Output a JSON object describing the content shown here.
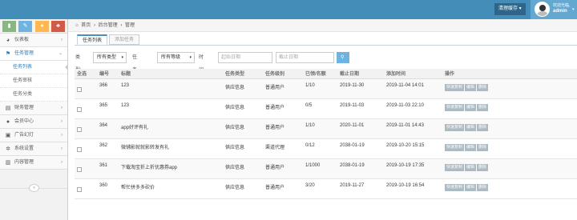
{
  "header": {
    "clear_cache_label": "清理缓存",
    "user_greeting": "欢迎光临,",
    "user_name": "admin"
  },
  "sidebar": {
    "shortcut_colors": [
      "#87b87f",
      "#6fb3e0",
      "#ffb752",
      "#d15b47"
    ],
    "items": [
      {
        "label": "仪表板",
        "icon": "dashboard-icon",
        "glyph": "◕"
      },
      {
        "label": "任务管理",
        "icon": "flag-icon",
        "glyph": "⚑",
        "open": true,
        "children": [
          "任务列表",
          "任务审核",
          "任务分类"
        ]
      },
      {
        "label": "财务管理",
        "icon": "wallet-icon",
        "glyph": "▤"
      },
      {
        "label": "会员中心",
        "icon": "user-icon",
        "glyph": "●"
      },
      {
        "label": "广告幻灯",
        "icon": "image-icon",
        "glyph": "▣"
      },
      {
        "label": "系统设置",
        "icon": "gear-icon",
        "glyph": "✲"
      },
      {
        "label": "内容管理",
        "icon": "book-icon",
        "glyph": "▥"
      }
    ]
  },
  "breadcrumb": [
    "首页",
    "后台管理",
    "管理"
  ],
  "tabs": [
    "任务列表",
    "添加任务"
  ],
  "filters": {
    "type_label": "类型:",
    "type_value": "所有类型",
    "level_label": "任务等级:",
    "level_value": "所有等级",
    "time_label": "时间段:",
    "start_placeholder": "起始日期",
    "end_placeholder": "截止日期",
    "search_label": "搜索"
  },
  "table": {
    "headers": [
      "全选",
      "编号",
      "标题",
      "任务类型",
      "任务级别",
      "已领/名额",
      "截止日期",
      "添加时间",
      "操作"
    ],
    "action_labels": [
      "快速复制",
      "编辑",
      "删除"
    ],
    "rows": [
      [
        "366",
        "123",
        "供应信息",
        "普通用户",
        "1/10",
        "2019-11-30",
        "2019-11-04 14:01"
      ],
      [
        "365",
        "123",
        "供应信息",
        "普通用户",
        "0/5",
        "2019-11-03",
        "2019-11-03 22:10"
      ],
      [
        "364",
        "app好评有礼",
        "供应信息",
        "普通用户",
        "1/10",
        "2020-11-01",
        "2019-11-01 14:43"
      ],
      [
        "362",
        "微铺影就就影转发有礼",
        "供应信息",
        "渠道代理",
        "0/12",
        "2038-01-19",
        "2019-10-20 15:15"
      ],
      [
        "361",
        "下载淘宝折上折优惠券app",
        "供应信息",
        "普通用户",
        "1/1000",
        "2038-01-19",
        "2019-10-19 17:35"
      ],
      [
        "360",
        "帮忙拼多多砍价",
        "供应信息",
        "普通用户",
        "3/20",
        "2019-11-27",
        "2019-10-19 16:54"
      ]
    ]
  }
}
